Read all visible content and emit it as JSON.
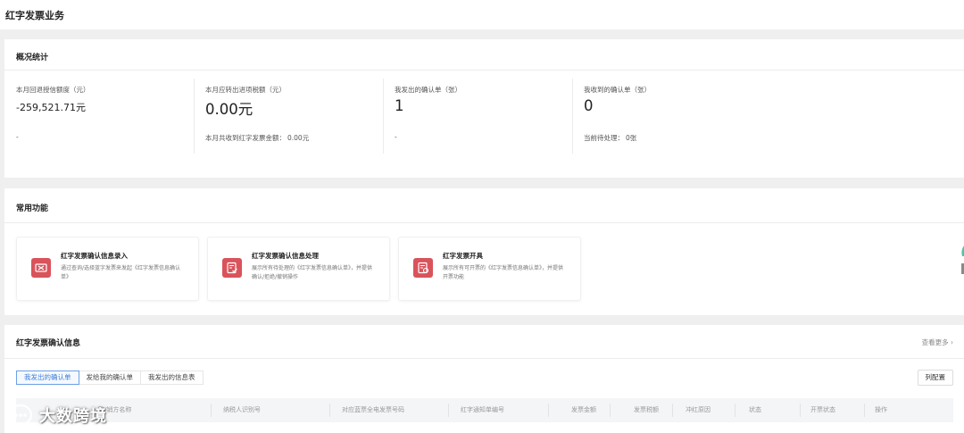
{
  "page": {
    "title": "红字发票业务"
  },
  "overview": {
    "title": "概况统计",
    "stats": [
      {
        "label": "本月回退授信额度（元）",
        "value": "-259,521.71元",
        "foot_label": "-",
        "foot_value": ""
      },
      {
        "label": "本月应转出进项税额（元）",
        "value": "0.00元",
        "foot_label": "本月共收到红字发票金额：",
        "foot_value": "0.00元"
      },
      {
        "label": "我发出的确认单（张）",
        "value": "1",
        "foot_label": "-",
        "foot_value": ""
      },
      {
        "label": "我收到的确认单（张）",
        "value": "0",
        "foot_label": "当前待处理：",
        "foot_value": "0张"
      }
    ]
  },
  "functions": {
    "title": "常用功能",
    "cards": [
      {
        "title": "红字发票确认信息录入",
        "desc": "通过查询/选择蓝字发票来发起《红字发票信息确认单》",
        "icon": "ticket-icon"
      },
      {
        "title": "红字发票确认信息处理",
        "desc": "展示所有待处理的《红字发票信息确认单》，并提供确认/拒绝/撤销操作",
        "icon": "document-check-icon"
      },
      {
        "title": "红字发票开具",
        "desc": "展示所有可开票的《红字发票信息确认单》，并提供开票功能",
        "icon": "invoice-issue-icon"
      }
    ],
    "accent_color": "#d9535b"
  },
  "confirm": {
    "title": "红字发票确认信息",
    "more_label": "查看更多",
    "tabs": [
      "我发出的确认单",
      "发给我的确认单",
      "我发出的信息表"
    ],
    "active_tab": 0,
    "config_label": "列配置",
    "columns": [
      "购/销方名称",
      "纳税人识别号",
      "对应蓝票全电发票号码",
      "红字通知单编号",
      "发票金额",
      "发票税额",
      "冲红原因",
      "状态",
      "开票状态",
      "操作"
    ]
  },
  "watermark": {
    "text": "大数跨境"
  }
}
